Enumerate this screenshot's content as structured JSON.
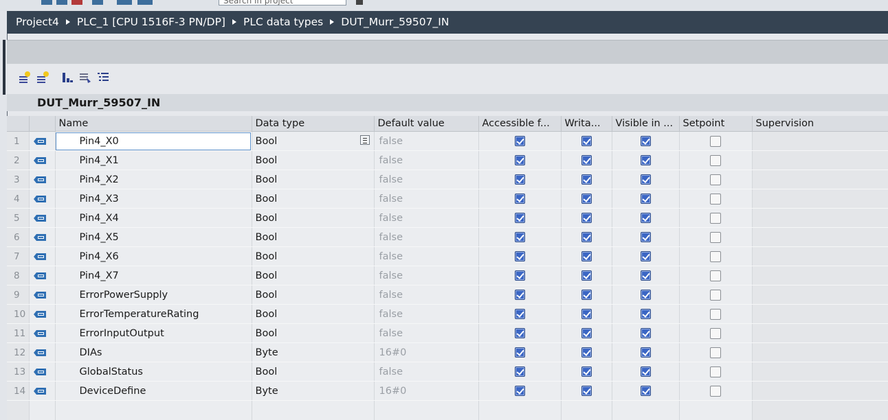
{
  "top": {
    "search_placeholder": "Search in project"
  },
  "breadcrumb": [
    {
      "label": "Project4"
    },
    {
      "label": "PLC_1 [CPU 1516F-3 PN/DP]"
    },
    {
      "label": "PLC data types"
    },
    {
      "label": "DUT_Murr_59507_IN"
    }
  ],
  "toolbar": [
    {
      "name": "insert-row-icon"
    },
    {
      "name": "add-row-icon"
    },
    {
      "name": "expand-all-icon"
    },
    {
      "name": "collapse-all-icon"
    },
    {
      "name": "list-view-icon"
    }
  ],
  "dut_title": "DUT_Murr_59507_IN",
  "columns": {
    "name": "Name",
    "data_type": "Data type",
    "default_value": "Default value",
    "accessible": "Accessible f...",
    "writable": "Writa...",
    "visible": "Visible in ...",
    "setpoint": "Setpoint",
    "supervision": "Supervision"
  },
  "rows": [
    {
      "num": "1",
      "name": "Pin4_X0",
      "type": "Bool",
      "default": "false"
    },
    {
      "num": "2",
      "name": "Pin4_X1",
      "type": "Bool",
      "default": "false"
    },
    {
      "num": "3",
      "name": "Pin4_X2",
      "type": "Bool",
      "default": "false"
    },
    {
      "num": "4",
      "name": "Pin4_X3",
      "type": "Bool",
      "default": "false"
    },
    {
      "num": "5",
      "name": "Pin4_X4",
      "type": "Bool",
      "default": "false"
    },
    {
      "num": "6",
      "name": "Pin4_X5",
      "type": "Bool",
      "default": "false"
    },
    {
      "num": "7",
      "name": "Pin4_X6",
      "type": "Bool",
      "default": "false"
    },
    {
      "num": "8",
      "name": "Pin4_X7",
      "type": "Bool",
      "default": "false"
    },
    {
      "num": "9",
      "name": "ErrorPowerSupply",
      "type": "Bool",
      "default": "false"
    },
    {
      "num": "10",
      "name": "ErrorTemperatureRating",
      "type": "Bool",
      "default": "false"
    },
    {
      "num": "11",
      "name": "ErrorInputOutput",
      "type": "Bool",
      "default": "false"
    },
    {
      "num": "12",
      "name": "DIAs",
      "type": "Byte",
      "default": "16#0"
    },
    {
      "num": "13",
      "name": "GlobalStatus",
      "type": "Bool",
      "default": "false"
    },
    {
      "num": "14",
      "name": "DeviceDefine",
      "type": "Byte",
      "default": "16#0"
    }
  ],
  "colors": {
    "breadcrumb_bg": "#354352",
    "checkbox": "#3b66c4",
    "tag_icon": "#2f6fb3"
  }
}
